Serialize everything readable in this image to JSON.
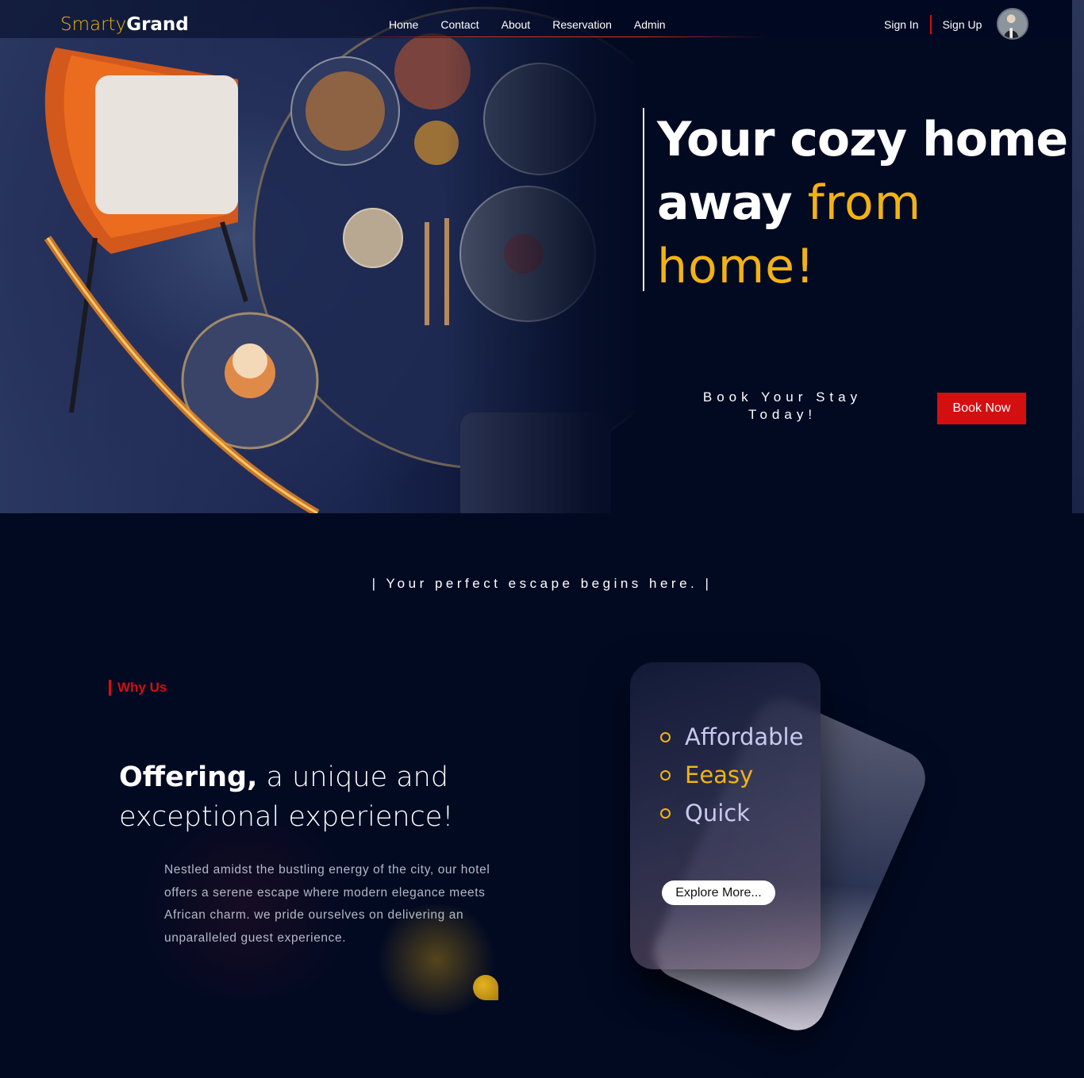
{
  "brand": {
    "part1": "Smarty",
    "part2": "Grand"
  },
  "nav": {
    "links": [
      "Home",
      "Contact",
      "About",
      "Reservation",
      "Admin"
    ],
    "sign_in": "Sign In",
    "sign_up": "Sign Up"
  },
  "hero": {
    "title_line1": "Your cozy home",
    "title_line2_bold": "away",
    "title_line2_accent": "from",
    "title_line3": "home!",
    "cta_text": "Book Your Stay Today!",
    "cta_button": "Book Now"
  },
  "tagline": "| Your perfect escape begins here. |",
  "why": {
    "label": "Why Us",
    "heading_bold": "Offering,",
    "heading_rest": " a unique and exceptional experience!",
    "blurb": "Nestled amidst the bustling energy of the city, our hotel offers a serene escape where modern elegance meets African charm. we pride ourselves on delivering an unparalleled guest experience."
  },
  "card": {
    "features": [
      "Affordable",
      "Eeasy",
      "Quick"
    ],
    "explore_button": "Explore More..."
  },
  "colors": {
    "background": "#020a22",
    "accent_yellow": "#f2b312",
    "accent_red": "#d40f10"
  }
}
